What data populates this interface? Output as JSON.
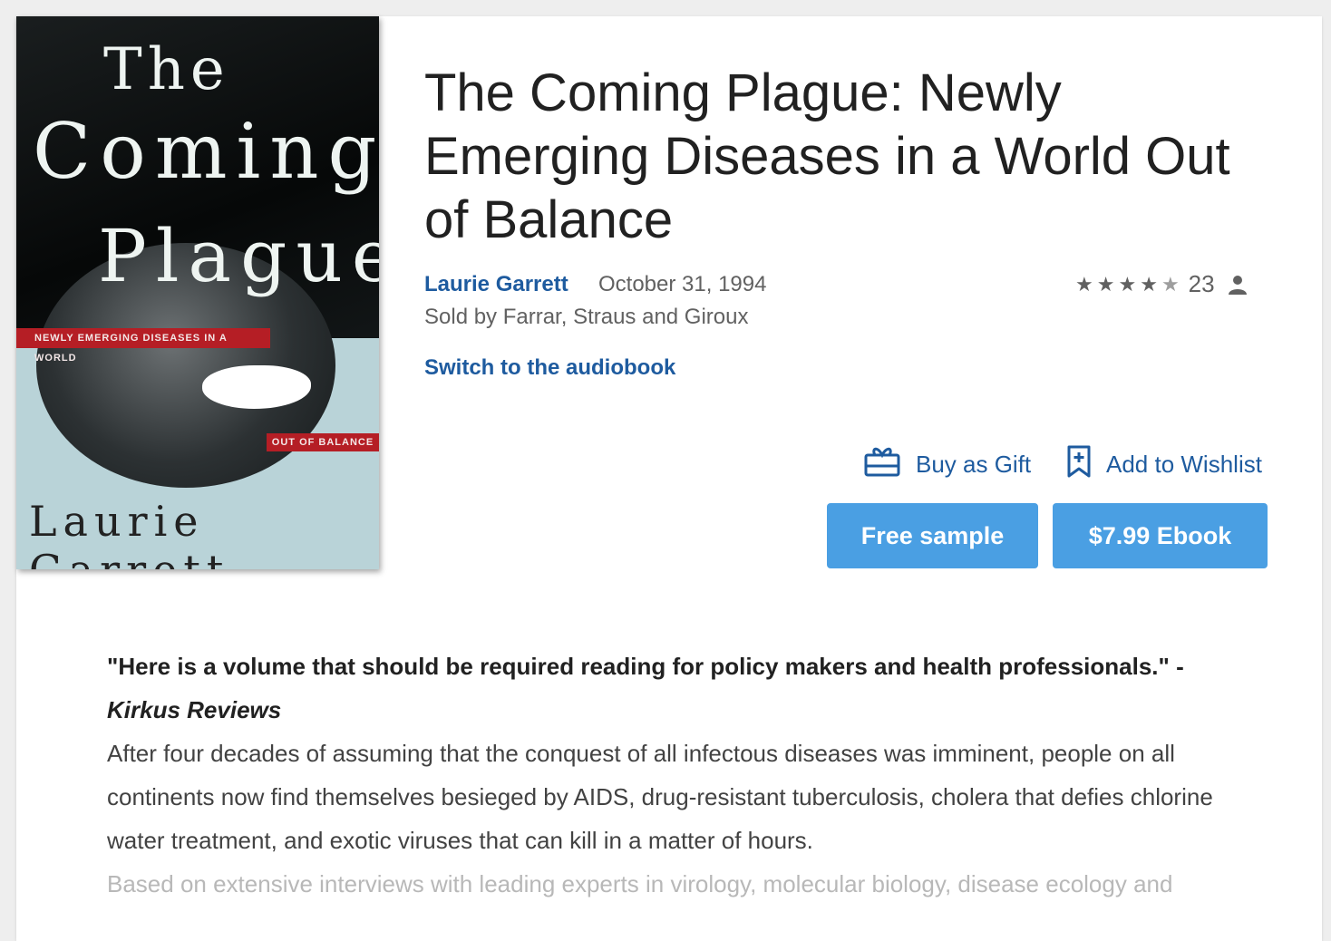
{
  "cover": {
    "title_line1": "The",
    "title_line2": "Coming",
    "title_line3": "Plague",
    "subtitle_band": "NEWLY EMERGING DISEASES IN A WORLD",
    "subtitle_band2": "OUT OF BALANCE",
    "author": "Laurie Garrett"
  },
  "book": {
    "title": "The Coming Plague: Newly Emerging Diseases in a World Out of Balance",
    "author": "Laurie Garrett",
    "date": "October 31, 1994",
    "sold_by": "Sold by Farrar, Straus and Giroux",
    "audiobook_link": "Switch to the audiobook"
  },
  "rating": {
    "stars": 4.5,
    "count": "23",
    "icon": "person-icon"
  },
  "actions": {
    "gift_label": "Buy as Gift",
    "gift_icon": "gift-card-icon",
    "wishlist_label": "Add to Wishlist",
    "wishlist_icon": "bookmark-add-icon",
    "sample_label": "Free sample",
    "buy_label": "$7.99 Ebook"
  },
  "description": {
    "quote": "\"Here is a volume that should be required reading for policy makers and health professionals.\" -",
    "quote_source": "Kirkus Reviews",
    "paragraph": "After four decades of assuming that the conquest of all infectous diseases was imminent, people on all continents now find themselves besieged by AIDS, drug-resistant tuberculosis, cholera that defies chlorine water treatment, and exotic viruses that can kill in a matter of hours.",
    "faded_line": "Based on extensive interviews with leading experts in virology, molecular biology, disease ecology and"
  },
  "colors": {
    "link": "#1e5b9f",
    "button": "#4a9fe3",
    "cover_band": "#b51e25"
  }
}
